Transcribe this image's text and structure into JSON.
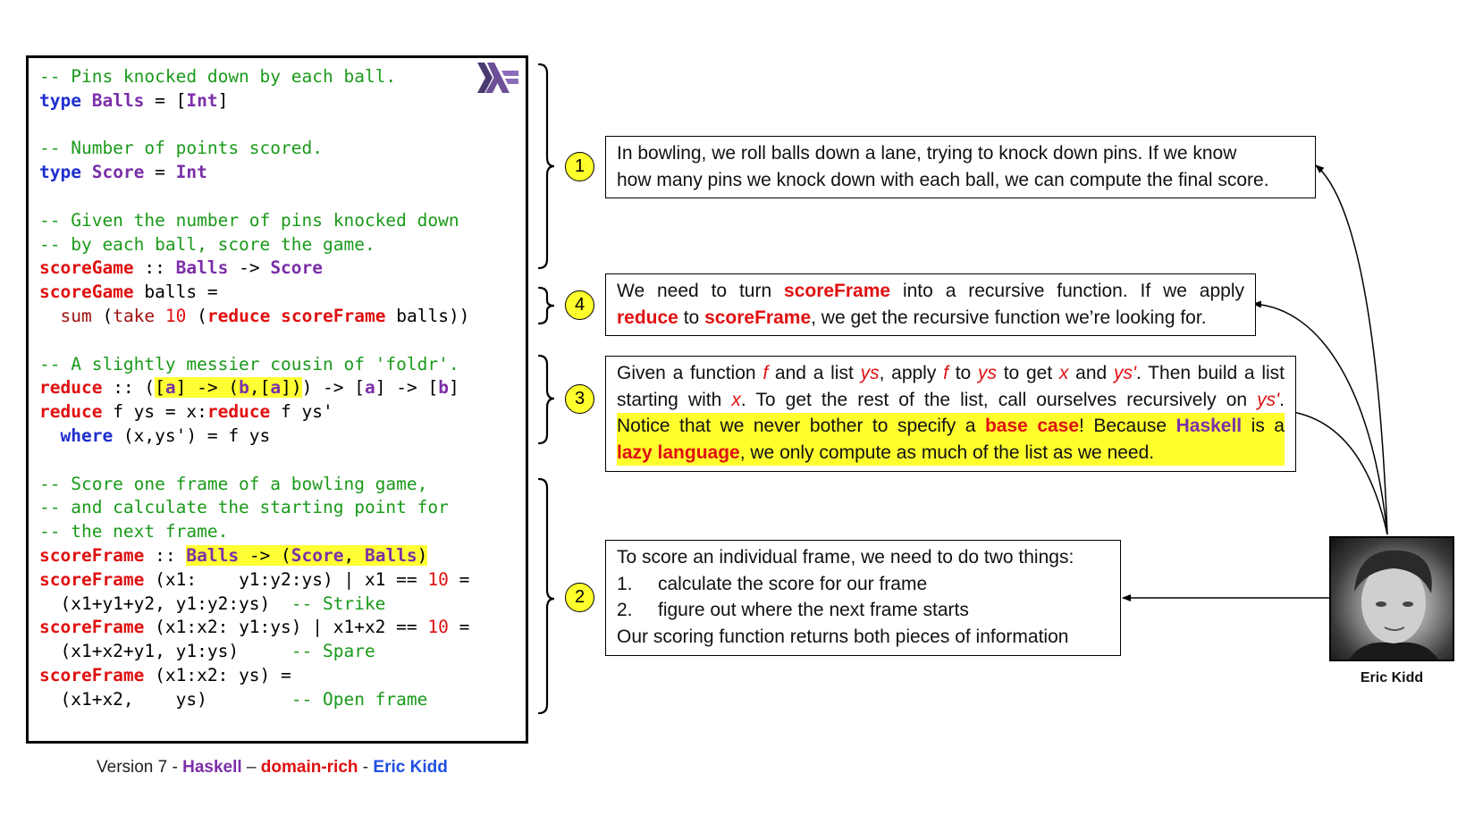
{
  "footer": {
    "version": "Version 7 - ",
    "haskell": "Haskell",
    "sep1": " – ",
    "domain": "domain-rich",
    "sep2": " - ",
    "author": "Eric Kidd"
  },
  "code": {
    "line1": "-- Pins knocked down by each ball.",
    "line3": "-- Number of points scored.",
    "line5": "-- Given the number of pins knocked down",
    "line6": "-- by each ball, score the game.",
    "line9": "-- A slightly messier cousin of 'foldr'.",
    "line12": "-- Score one frame of a bowling game,",
    "line13": "-- and calculate the starting point for",
    "line14": "-- the next frame."
  },
  "callouts": [
    {
      "number": "1"
    },
    {
      "number": "4"
    },
    {
      "number": "3"
    },
    {
      "number": "2"
    }
  ],
  "notes": {
    "n1_line1": "In bowling, we roll balls down a lane, trying to knock down pins. If we know",
    "n1_line2": "how many pins we knock down with each ball, we can compute the final score.",
    "n2_line1": "To score an individual frame, we need to do two things:",
    "n2_item1_num": "1.",
    "n2_item1": "calculate the score for our frame",
    "n2_item2_num": "2.",
    "n2_item2": "figure out where the next frame starts",
    "n2_line4": "Our scoring function returns both pieces of information"
  },
  "photo_caption": "Eric Kidd"
}
